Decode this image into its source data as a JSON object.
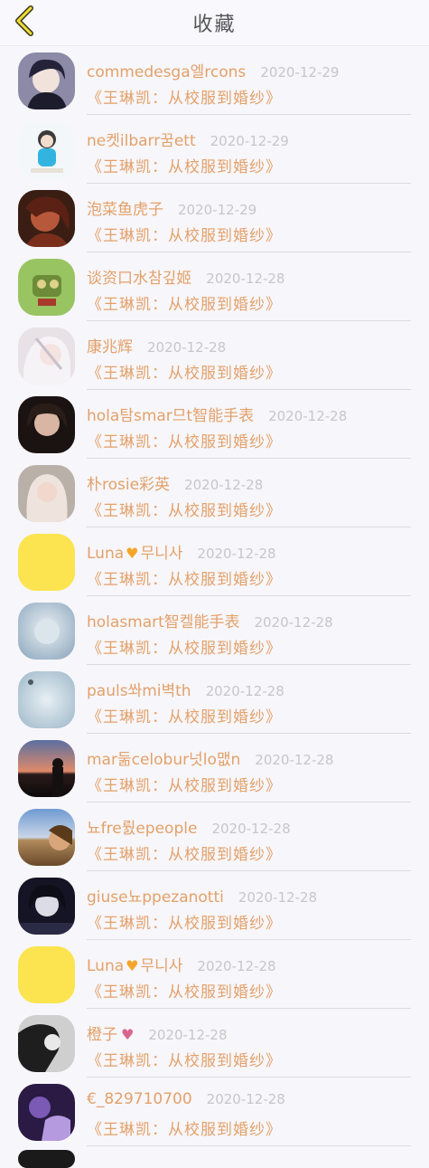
{
  "header": {
    "title": "收藏"
  },
  "items": [
    {
      "name": "commedesga엘rcons",
      "date": "2020-12-29",
      "work": "《王琳凯：从校服到婚纱》",
      "avatar": "anime-boy"
    },
    {
      "name": "ne켓ilbarr꿈ett",
      "date": "2020-12-29",
      "work": "《王琳凯：从校服到婚纱》",
      "avatar": "cartoon-girl"
    },
    {
      "name": "泡菜鱼虎子",
      "date": "2020-12-29",
      "work": "《王琳凯：从校服到婚纱》",
      "avatar": "red-portrait"
    },
    {
      "name": "谈资口水참깊姬",
      "date": "2020-12-28",
      "work": "《王琳凯：从校服到婚纱》",
      "avatar": "green-toy"
    },
    {
      "name": "康兆辉",
      "date": "2020-12-28",
      "work": "《王琳凯：从校服到婚纱》",
      "avatar": "anime-white"
    },
    {
      "name": "hola탐smar므t智能手表",
      "date": "2020-12-28",
      "work": "《王琳凯：从校服到婚纱》",
      "avatar": "dark-girl"
    },
    {
      "name": "朴rosie彩英",
      "date": "2020-12-28",
      "work": "《王琳凯：从校服到婚纱》",
      "avatar": "blonde-girl"
    },
    {
      "name": "Luna",
      "heart": "♥",
      "name_suffix": "무니사",
      "date": "2020-12-28",
      "work": "《王琳凯：从校服到婚纱》",
      "avatar": "yellow"
    },
    {
      "name": "holasmart智켈能手表",
      "date": "2020-12-28",
      "work": "《王琳凯：从校服到婚纱》",
      "avatar": "blur-blue"
    },
    {
      "name": "pauls쏴mi벽th",
      "date": "2020-12-28",
      "work": "《王琳凯：从校服到婚纱》",
      "avatar": "blur-blue2"
    },
    {
      "name": "mar둚celobur넛lo맶n",
      "date": "2020-12-28",
      "work": "《王琳凯：从校服到婚纱》",
      "avatar": "sunset"
    },
    {
      "name": "뇨fre뤐epeople",
      "date": "2020-12-28",
      "work": "《王琳凯：从校服到婚纱》",
      "avatar": "beach"
    },
    {
      "name": "giuse뇨ppezanotti",
      "date": "2020-12-28",
      "work": "《王琳凯：从校服到婚纱》",
      "avatar": "night-girl"
    },
    {
      "name": "Luna",
      "heart": "♥",
      "name_suffix": "무니사",
      "date": "2020-12-28",
      "work": "《王琳凯：从校服到婚纱》",
      "avatar": "yellow"
    },
    {
      "name": "橙子",
      "heart_pink": "♥",
      "date": "2020-12-28",
      "work": "《王琳凯：从校服到婚纱》",
      "avatar": "bw-girl"
    },
    {
      "name": "€_829710700",
      "date": "2020-12-28",
      "work": "《王琳凯：从校服到婚纱》",
      "avatar": "purple"
    }
  ]
}
